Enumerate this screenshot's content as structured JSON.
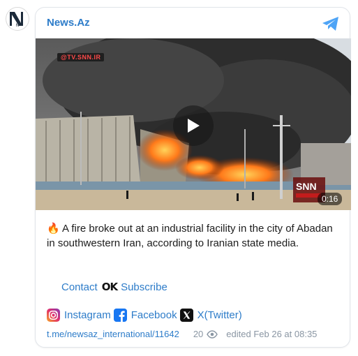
{
  "channel": {
    "name": "News.Az",
    "avatar_letter": "N"
  },
  "video": {
    "source_tag": "@TV.SNN.IR",
    "logo_text": "SNN",
    "duration": "0:16"
  },
  "post": {
    "emoji": "🔥",
    "text": "A fire broke out at an industrial facility in the city of Abadan in southwestern Iran, according to Iranian state media."
  },
  "links": {
    "contact": "Contact",
    "ok_logo": "OK",
    "subscribe": "Subscribe"
  },
  "social": [
    {
      "label": "Instagram",
      "icon": "instagram-icon"
    },
    {
      "label": "Facebook",
      "icon": "facebook-icon"
    },
    {
      "label": "X(Twitter)",
      "icon": "x-twitter-icon"
    }
  ],
  "footer": {
    "message_link": "t.me/newsaz_international/11642",
    "views": "20",
    "edited": "edited",
    "date": "Feb 26 at 08:35"
  },
  "colors": {
    "link": "#2d7cc9",
    "telegram": "#4ea4f6"
  }
}
